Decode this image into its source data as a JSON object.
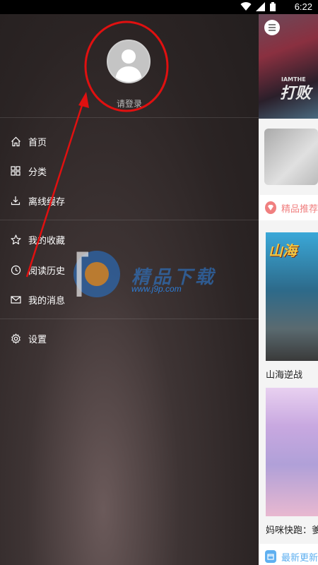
{
  "status": {
    "time": "6:22"
  },
  "drawer": {
    "login_label": "请登录",
    "menu": [
      {
        "label": "首页",
        "icon": "home-icon"
      },
      {
        "label": "分类",
        "icon": "grid-icon"
      },
      {
        "label": "离线缓存",
        "icon": "download-icon"
      },
      {
        "label": "我的收藏",
        "icon": "star-icon"
      },
      {
        "label": "阅读历史",
        "icon": "clock-icon"
      },
      {
        "label": "我的消息",
        "icon": "mail-icon"
      },
      {
        "label": "设置",
        "icon": "gear-icon"
      }
    ]
  },
  "watermark": {
    "url": "www.j9p.com",
    "text": "精品下载"
  },
  "content": {
    "banner_text": "打败",
    "banner_sub": "IAMTHE",
    "section_featured": "精品推荐",
    "comics": [
      {
        "title": "山海逆战",
        "logo": "山海"
      },
      {
        "title": "妈咪快跑：爹"
      }
    ],
    "section_latest": "最新更新"
  },
  "colors": {
    "featured_accent": "#f08080",
    "latest_accent": "#5fb0f0",
    "annotation": "#e01010"
  }
}
